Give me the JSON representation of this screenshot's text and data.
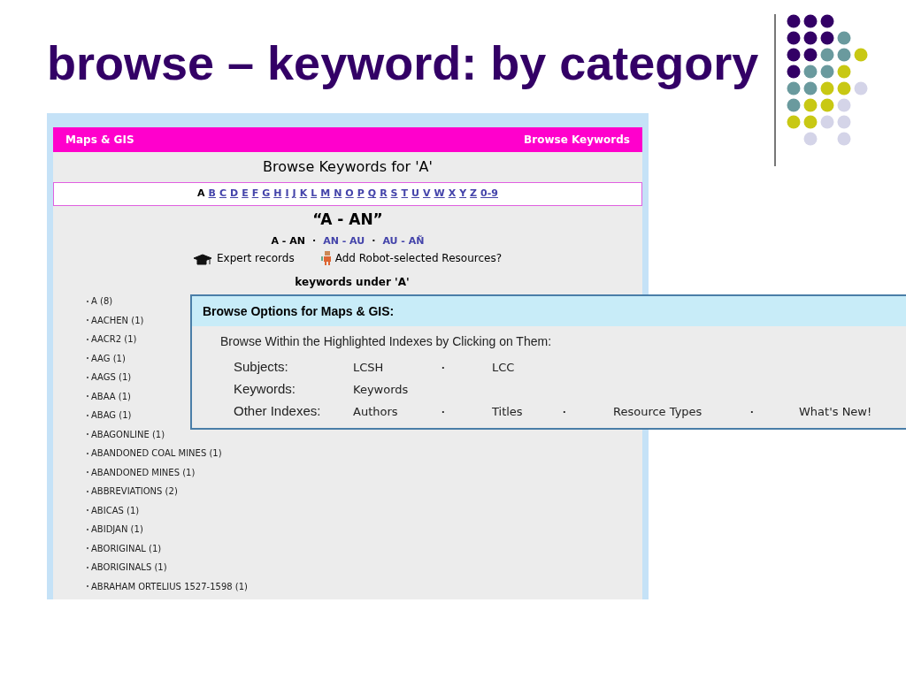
{
  "slide": {
    "title": "browse – keyword: by category"
  },
  "page": {
    "header": {
      "left": "Maps & GIS",
      "right": "Browse Keywords"
    },
    "heading": "Browse Keywords for 'A'",
    "letters": [
      {
        "label": "A",
        "selected": true
      },
      {
        "label": "B",
        "selected": false
      },
      {
        "label": "C",
        "selected": false
      },
      {
        "label": "D",
        "selected": false
      },
      {
        "label": "E",
        "selected": false
      },
      {
        "label": "F",
        "selected": false
      },
      {
        "label": "G",
        "selected": false
      },
      {
        "label": "H",
        "selected": false
      },
      {
        "label": "I",
        "selected": false
      },
      {
        "label": "J",
        "selected": false
      },
      {
        "label": "K",
        "selected": false
      },
      {
        "label": "L",
        "selected": false
      },
      {
        "label": "M",
        "selected": false
      },
      {
        "label": "N",
        "selected": false
      },
      {
        "label": "O",
        "selected": false
      },
      {
        "label": "P",
        "selected": false
      },
      {
        "label": "Q",
        "selected": false
      },
      {
        "label": "R",
        "selected": false
      },
      {
        "label": "S",
        "selected": false
      },
      {
        "label": "T",
        "selected": false
      },
      {
        "label": "U",
        "selected": false
      },
      {
        "label": "V",
        "selected": false
      },
      {
        "label": "W",
        "selected": false
      },
      {
        "label": "X",
        "selected": false
      },
      {
        "label": "Y",
        "selected": false
      },
      {
        "label": "Z",
        "selected": false
      },
      {
        "label": "0-9",
        "selected": false
      }
    ],
    "range_title": "“A - AN”",
    "ranges": [
      {
        "kind": "link",
        "label": "A - AN",
        "selected": true
      },
      {
        "kind": "separator",
        "label": "·"
      },
      {
        "kind": "link",
        "label": "AN - AU",
        "selected": false
      },
      {
        "kind": "separator",
        "label": "·"
      },
      {
        "kind": "link",
        "label": "AU - AÑ",
        "selected": false
      }
    ],
    "expert_link": "Expert records",
    "robot_link": "Add Robot-selected Resources?",
    "keywords_heading": "keywords under 'A'",
    "keywords": [
      "A (8)",
      "AACHEN (1)",
      "AACR2 (1)",
      "AAG (1)",
      "AAGS (1)",
      "ABAA (1)",
      "ABAG (1)",
      "ABAGONLINE (1)",
      "ABANDONED COAL MINES (1)",
      "ABANDONED MINES (1)",
      "ABBREVIATIONS (2)",
      "ABICAS (1)",
      "ABIDJAN (1)",
      "ABORIGINAL (1)",
      "ABORIGINALS (1)",
      "ABRAHAM ORTELIUS 1527-1598 (1)"
    ]
  },
  "options": {
    "title": "Browse Options for Maps & GIS:",
    "intro": "Browse Within the Highlighted Indexes by Clicking on Them:",
    "rows": [
      {
        "label": "Subjects:",
        "items": [
          {
            "kind": "link",
            "label": "LCSH"
          },
          {
            "kind": "separator",
            "label": "·"
          },
          {
            "kind": "link",
            "label": "LCC"
          }
        ]
      },
      {
        "label": "Keywords:",
        "items": [
          {
            "kind": "link",
            "label": "Keywords"
          }
        ]
      },
      {
        "label": "Other Indexes:",
        "items": [
          {
            "kind": "link",
            "label": "Authors"
          },
          {
            "kind": "separator",
            "label": "·"
          },
          {
            "kind": "link",
            "label": "Titles"
          },
          {
            "kind": "separator",
            "label": "·"
          },
          {
            "kind": "link",
            "label": "Resource Types"
          },
          {
            "kind": "separator",
            "label": "·"
          },
          {
            "kind": "link",
            "label": "What's New!"
          }
        ]
      }
    ]
  }
}
